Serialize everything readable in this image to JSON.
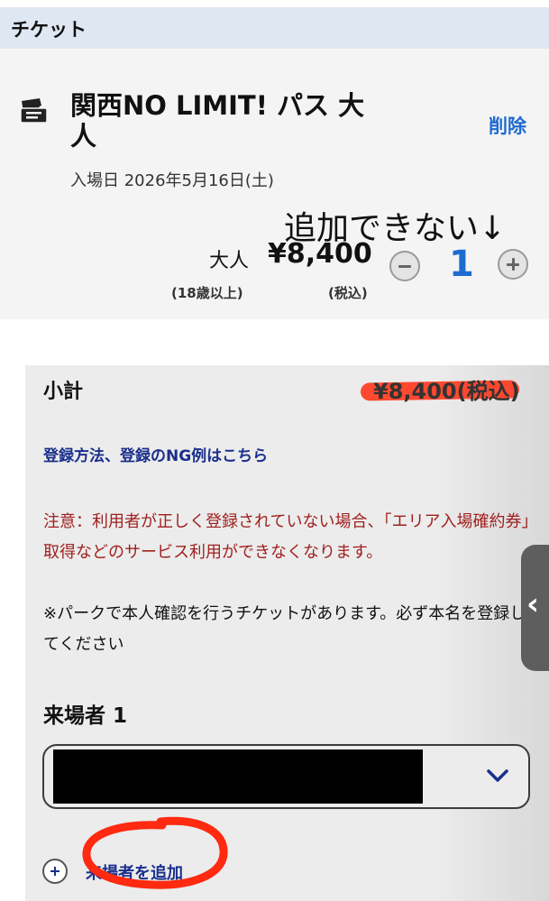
{
  "header": {
    "title": "チケット"
  },
  "ticket": {
    "icon": "ticket-icon",
    "name": "関西NO LIMIT! パス 大人",
    "delete_label": "削除",
    "entry_date": "入場日 2026年5月16日(土)",
    "annotation": "追加できない↓",
    "price": {
      "category": "大人",
      "amount": "¥8,400",
      "age_note": "(18歳以上)",
      "tax_note": "(税込)"
    },
    "quantity": {
      "value": "1",
      "minus_icon": "minus-circle-icon",
      "plus_icon": "plus-circle-icon"
    }
  },
  "summary": {
    "subtotal_label": "小計",
    "subtotal_amount": "¥8,400(税込)",
    "registration_link": "登録方法、登録のNG例はこちら",
    "caution": "注意：利用者が正しく登録されていない場合、「エリア入場確約券」取得などのサービス利用ができなくなります。",
    "note": "※パークで本人確認を行うチケットがあります。必ず本名を登録してください"
  },
  "visitor": {
    "title": "来場者 1",
    "select_icon": "chevron-down-icon",
    "add_label": "来場者を追加",
    "add_icon": "plus-circle-icon"
  },
  "side_tab": {
    "icon": "chevron-left-icon"
  },
  "colors": {
    "accent_blue": "#1e6bd0",
    "link_navy": "#1a2f8c",
    "caution_red": "#a0211f",
    "marker_red": "#ff3b1f"
  }
}
